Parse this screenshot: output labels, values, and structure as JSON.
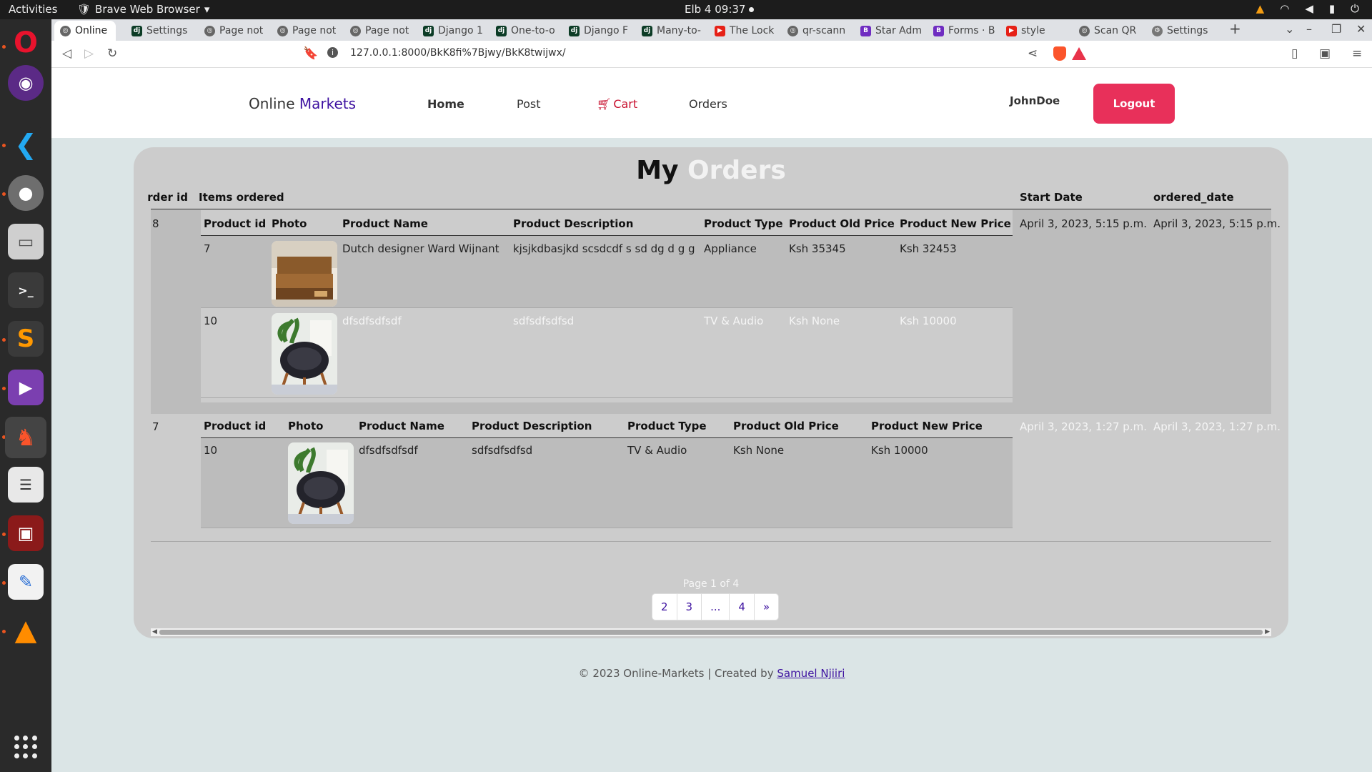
{
  "system": {
    "activities": "Activities",
    "app_name": "Brave Web Browser",
    "clock": "Elb 4  09:37"
  },
  "browser": {
    "tabs": [
      {
        "label": "Online",
        "icon": "globe-icon",
        "active": true
      },
      {
        "label": "Settings",
        "icon": "django-icon"
      },
      {
        "label": "Page not",
        "icon": "globe-icon"
      },
      {
        "label": "Page not",
        "icon": "globe-icon"
      },
      {
        "label": "Page not",
        "icon": "globe-icon"
      },
      {
        "label": "Django 1",
        "icon": "django-icon"
      },
      {
        "label": "One-to-o",
        "icon": "django-icon"
      },
      {
        "label": "Django F",
        "icon": "django-icon"
      },
      {
        "label": "Many-to-",
        "icon": "django-icon"
      },
      {
        "label": "The Lock",
        "icon": "youtube-icon"
      },
      {
        "label": "qr-scann",
        "icon": "globe-icon"
      },
      {
        "label": "Star Adm",
        "icon": "bootstrap-icon"
      },
      {
        "label": "Forms · B",
        "icon": "bootstrap-icon"
      },
      {
        "label": "style",
        "icon": "youtube-icon"
      },
      {
        "label": "Scan QR",
        "icon": "globe-icon"
      },
      {
        "label": "Settings",
        "icon": "gear-icon"
      }
    ],
    "url": "127.0.0.1:8000/BkK8fi%7Bjwy/BkK8twijwx/"
  },
  "navbar": {
    "brand_prefix": "Online",
    "brand_accent": "Markets",
    "links": {
      "home": "Home",
      "post": "Post",
      "cart": "Cart",
      "orders": "Orders"
    },
    "username": "JohnDoe",
    "logout": "Logout"
  },
  "title": {
    "part1": "My",
    "part2": "Orders"
  },
  "columns": {
    "order_id": "Order id",
    "items_ordered": "Items ordered",
    "start_date": "Start Date",
    "ordered_date": "ordered_date"
  },
  "item_columns": {
    "product_id": "Product id",
    "photo": "Photo",
    "name": "Product Name",
    "description": "Product Description",
    "type": "Product Type",
    "old_price": "Product Old Price",
    "new_price": "Product New Price"
  },
  "orders": [
    {
      "id": "8",
      "start_date": "April 3, 2023, 5:15 p.m.",
      "ordered_date": "April 3, 2023, 5:15 p.m.",
      "items": [
        {
          "product_id": "7",
          "photo": "bed-photo",
          "name": "Dutch designer Ward Wijnant",
          "description": "kjsjkdbasjkd scsdcdf s sd dg d g g",
          "type": "Appliance",
          "old_price": "Ksh 35345",
          "new_price": "Ksh 32453"
        },
        {
          "product_id": "10",
          "photo": "chair-photo",
          "name": "dfsdfsdfsdf",
          "description": "sdfsdfsdfsd",
          "type": "TV & Audio",
          "old_price": "Ksh None",
          "new_price": "Ksh 10000"
        }
      ]
    },
    {
      "id": "7",
      "start_date": "April 3, 2023, 1:27 p.m.",
      "ordered_date": "April 3, 2023, 1:27 p.m.",
      "items": [
        {
          "product_id": "10",
          "photo": "chair-photo",
          "name": "dfsdfsdfsdf",
          "description": "sdfsdfsdfsd",
          "type": "TV & Audio",
          "old_price": "Ksh None",
          "new_price": "Ksh 10000"
        }
      ]
    }
  ],
  "pagination": {
    "info": "Page 1 of 4",
    "links": [
      "2",
      "3",
      "...",
      "4",
      "»"
    ]
  },
  "footer": {
    "text": "© 2023 Online-Markets | Created by",
    "author": "Samuel Njiiri"
  },
  "colors": {
    "accent": "#3d11a0",
    "logout": "#e8305a",
    "cart": "#c8102e",
    "card": "#cccccc",
    "page_bg": "#dbe5e6"
  }
}
